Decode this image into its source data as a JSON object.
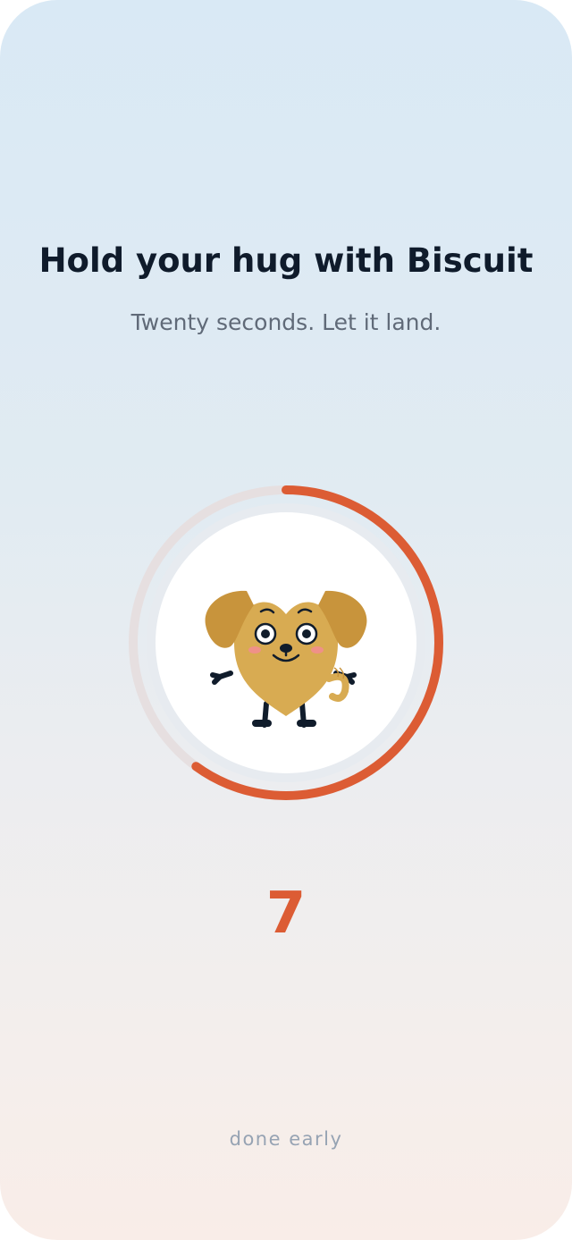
{
  "screen": {
    "title": "Hold your hug with Biscuit",
    "subtitle": "Twenty seconds. Let it land."
  },
  "timer": {
    "remaining": "7",
    "progress_fraction": 0.6,
    "ring_color": "#dc5c34",
    "track_color": "#e6dfe0"
  },
  "mascot": {
    "icon": "heart-dog-mascot-icon",
    "body_color": "#d8ab52",
    "ear_color": "#c8943c"
  },
  "actions": {
    "done_early_label": "done early"
  }
}
